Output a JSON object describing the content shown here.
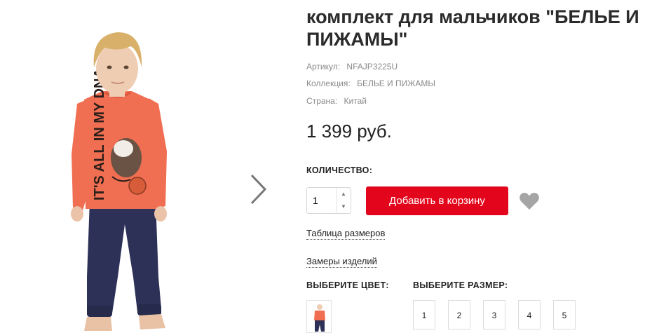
{
  "product": {
    "title_line1": "комплект для мальчиков \"БЕЛЬЕ И",
    "title_line2": "ПИЖАМЫ\"",
    "article_label": "Артикул:",
    "article_value": "NFAJP3225U",
    "collection_label": "Коллекция:",
    "collection_value": "БЕЛЬЕ И ПИЖАМЫ",
    "country_label": "Страна:",
    "country_value": "Китай",
    "price": "1 399 руб.",
    "shirt_print": "IT'S ALL IN MY DNA"
  },
  "purchase": {
    "quantity_label": "КОЛИЧЕСТВО:",
    "quantity_value": "1",
    "add_to_cart_label": "Добавить в корзину"
  },
  "links": {
    "size_table": "Таблица размеров",
    "measurements": "Замеры изделий"
  },
  "options": {
    "color_label": "ВЫБЕРИТЕ ЦВЕТ:",
    "size_label": "ВЫБЕРИТЕ РАЗМЕР:",
    "sizes": [
      "1",
      "2",
      "3",
      "4",
      "5"
    ]
  },
  "colors": {
    "accent_red": "#e3051b",
    "shirt_coral": "#f06e52",
    "pants_navy": "#2d3157"
  },
  "icons": {
    "next": "chevron-right-icon",
    "wishlist": "heart-icon"
  }
}
